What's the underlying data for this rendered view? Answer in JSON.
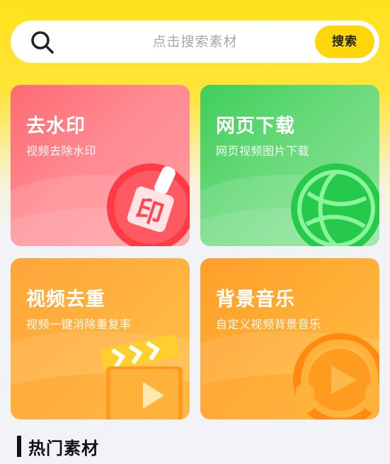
{
  "search": {
    "placeholder": "点击搜索素材",
    "button_label": "搜索",
    "icon": "search-icon"
  },
  "cards": [
    {
      "title": "去水印",
      "subtitle": "视频去除水印",
      "icon": "stamp-icon",
      "color": "#ff6a72"
    },
    {
      "title": "网页下载",
      "subtitle": "网页视频图片下载",
      "icon": "globe-icon",
      "color": "#3fce5a"
    },
    {
      "title": "视频去重",
      "subtitle": "视频一键消除重复率",
      "icon": "clapperboard-icon",
      "color": "#ffa53a"
    },
    {
      "title": "背景音乐",
      "subtitle": "自定义视频背景音乐",
      "icon": "headphones-icon",
      "color": "#ff9f2b"
    }
  ],
  "section": {
    "title": "热门素材"
  },
  "colors": {
    "accent": "#ffd60a",
    "background_top": "#ffe11a"
  }
}
